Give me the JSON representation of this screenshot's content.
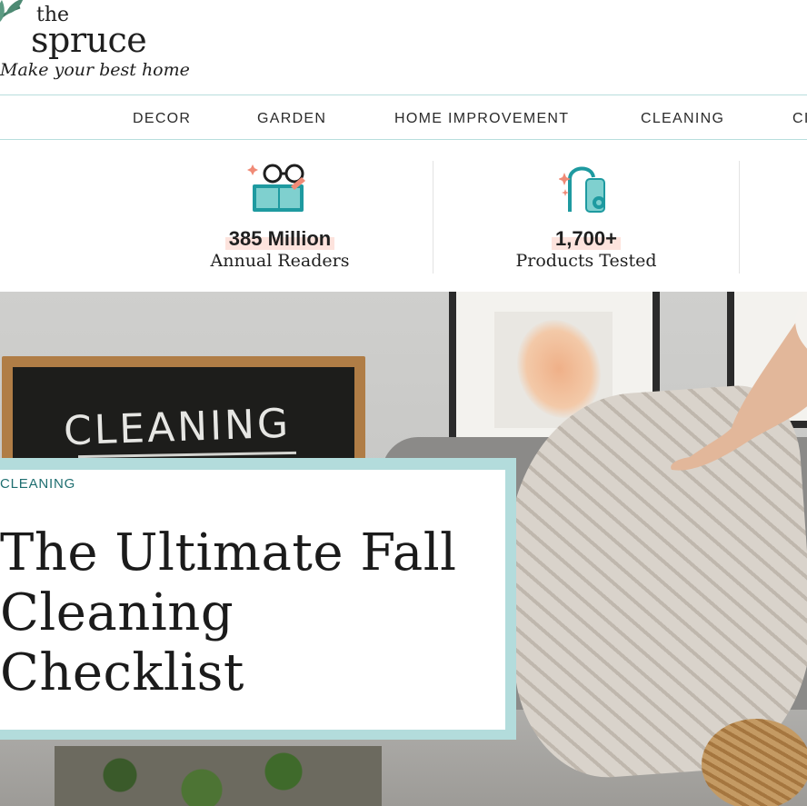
{
  "logo": {
    "line1": "the",
    "line2": "spruce",
    "tagline": "Make your best home",
    "leaf_color": "#3f7a64"
  },
  "nav": {
    "items": [
      {
        "label": "DECOR"
      },
      {
        "label": "GARDEN"
      },
      {
        "label": "HOME IMPROVEMENT"
      },
      {
        "label": "CLEANING"
      },
      {
        "label": "CI"
      }
    ]
  },
  "stats": [
    {
      "number": "385 Million",
      "label": "Annual Readers",
      "icon": "reading-glasses-icon"
    },
    {
      "number": "1,700+",
      "label": "Products Tested",
      "icon": "vacuum-icon"
    }
  ],
  "hero": {
    "chalkboard_text": "CLEANING",
    "category": "CLEANING",
    "title": "The Ultimate Fall Cleaning Checklist"
  },
  "colors": {
    "accent_teal": "#1e9aa0",
    "nav_border": "#b8dedd",
    "card_frame": "#b3dcdc",
    "highlight_pink": "#fde3dd",
    "category_text": "#1e6e70"
  }
}
